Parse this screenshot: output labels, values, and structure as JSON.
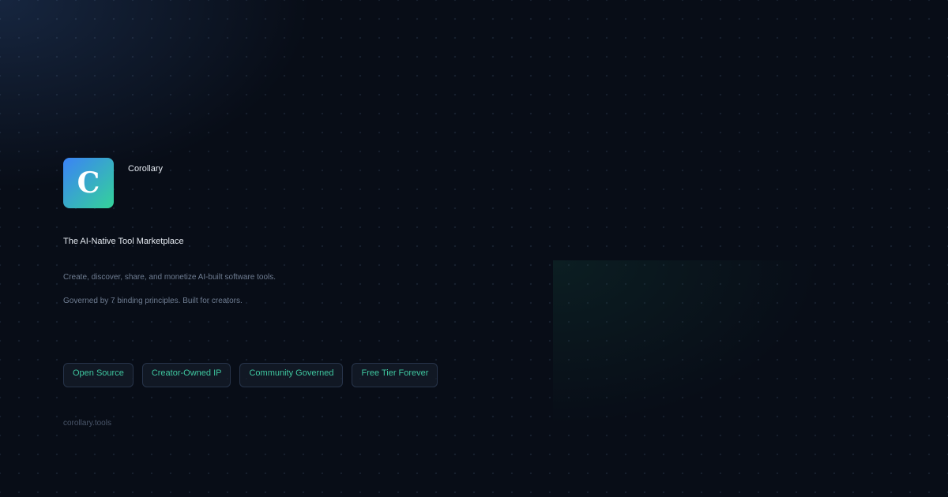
{
  "brand": {
    "logo_letter": "C",
    "name": "Corollary"
  },
  "hero": {
    "tagline": "The AI-Native Tool Marketplace",
    "description_line1": "Create, discover, share, and monetize AI-built software tools.",
    "description_line2": "Governed by 7 binding principles. Built for creators."
  },
  "badges": [
    {
      "label": "Open Source"
    },
    {
      "label": "Creator-Owned IP"
    },
    {
      "label": "Community Governed"
    },
    {
      "label": "Free Tier Forever"
    }
  ],
  "footer": {
    "domain": "corollary.tools"
  },
  "colors": {
    "background": "#080d17",
    "accent_green": "#3fc7a0",
    "logo_gradient_start": "#3b82f6",
    "logo_gradient_end": "#34d399"
  }
}
